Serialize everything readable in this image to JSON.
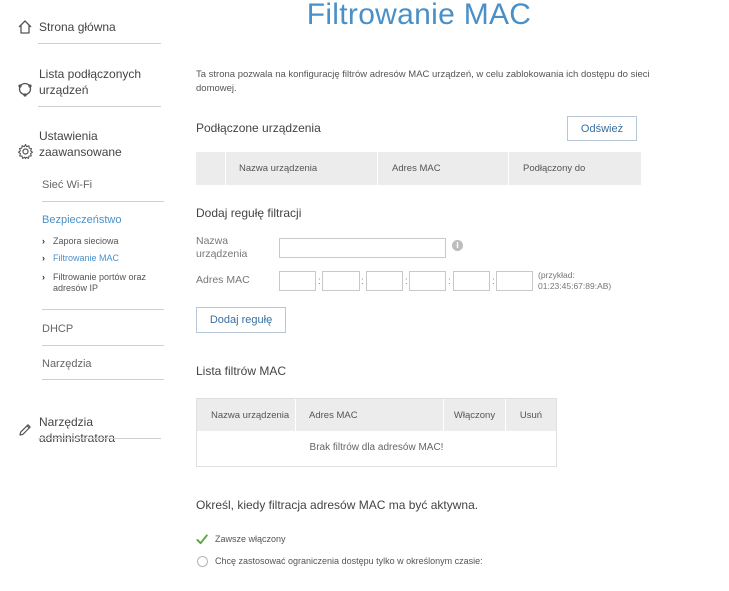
{
  "sidebar": {
    "home": "Strona główna",
    "devices": "Lista podłączonych urządzeń",
    "advanced": "Ustawienia zaawansowane",
    "wifi": "Sieć Wi-Fi",
    "security": "Bezpieczeństwo",
    "security_items": [
      "Zapora sieciowa",
      "Filtrowanie MAC",
      "Filtrowanie portów oraz adresów IP"
    ],
    "dhcp": "DHCP",
    "tools": "Narzędzia",
    "admin_tools": "Narzędzia administratora"
  },
  "page": {
    "title": "Filtrowanie MAC",
    "description": "Ta strona pozwala na konfigurację filtrów adresów MAC urządzeń, w celu zablokowania ich dostępu do sieci domowej."
  },
  "connected": {
    "heading": "Podłączone urządzenia",
    "refresh_button": "Odśwież",
    "columns": [
      "Nazwa urządzenia",
      "Adres MAC",
      "Podłączony do"
    ]
  },
  "add_rule": {
    "heading": "Dodaj regułę filtracji",
    "device_name_label": "Nazwa urządzenia",
    "device_name_value": "",
    "mac_label": "Adres MAC",
    "mac_separator": ":",
    "example": "(przykład: 01:23:45:67:89:AB)",
    "button": "Dodaj regułę"
  },
  "filter_list": {
    "heading": "Lista filtrów MAC",
    "columns": [
      "Nazwa urządzenia",
      "Adres MAC",
      "Włączony",
      "Usuń"
    ],
    "empty": "Brak filtrów dla adresów MAC!"
  },
  "schedule": {
    "heading": "Określ, kiedy filtracja adresów MAC ma być aktywna.",
    "options": [
      "Zawsze włączony",
      "Chcę zastosować ograniczenia dostępu tylko w określonym czasie:"
    ],
    "selected_index": 0
  },
  "colors": {
    "accent": "#4a90c8",
    "check": "#5aa53a"
  }
}
